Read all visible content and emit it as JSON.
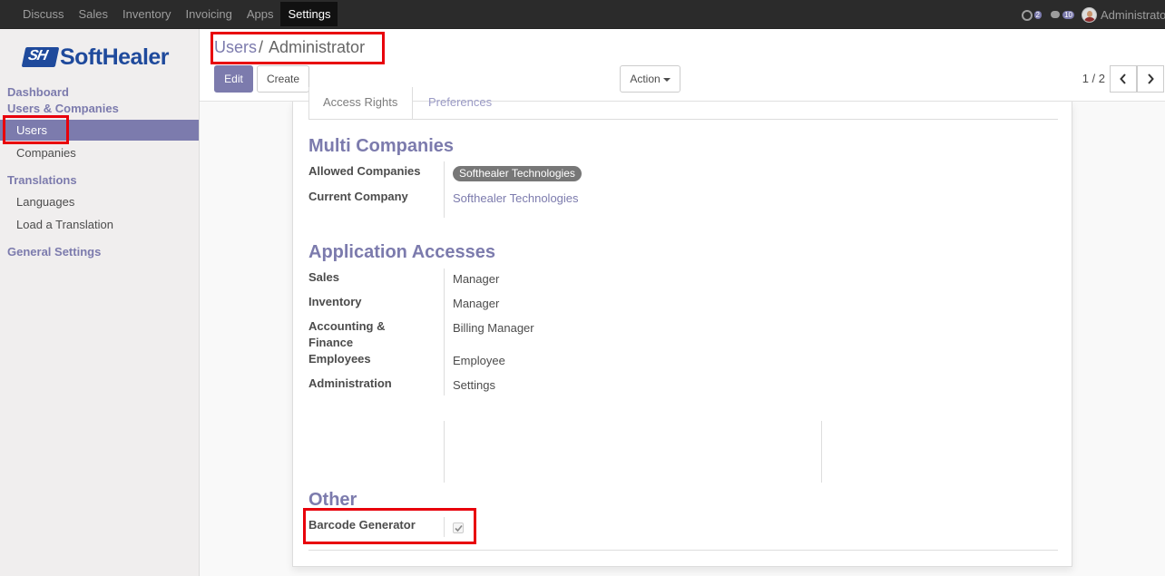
{
  "topbar": {
    "menu": [
      "Discuss",
      "Sales",
      "Inventory",
      "Invoicing",
      "Apps",
      "Settings"
    ],
    "active_menu": "Settings",
    "activity_count": "2",
    "message_count": "10",
    "username": "Administrator"
  },
  "sidebar": {
    "logo_mark": "SH",
    "logo_text": "SoftHealer",
    "dashboard": "Dashboard",
    "users_companies": "Users & Companies",
    "users": "Users",
    "companies": "Companies",
    "translations": "Translations",
    "languages": "Languages",
    "load_translation": "Load a Translation",
    "general_settings": "General Settings"
  },
  "controlpanel": {
    "breadcrumb_parent": "Users",
    "breadcrumb_sep": "/",
    "breadcrumb_current": "Administrator",
    "edit": "Edit",
    "create": "Create",
    "action": "Action",
    "pager": "1 / 2"
  },
  "form": {
    "tabs": {
      "access_rights": "Access Rights",
      "preferences": "Preferences"
    },
    "multi_companies": {
      "title": "Multi Companies",
      "allowed_label": "Allowed Companies",
      "allowed_value": "Softhealer Technologies",
      "current_label": "Current Company",
      "current_value": "Softhealer Technologies"
    },
    "application_accesses": {
      "title": "Application Accesses",
      "sales_label": "Sales",
      "sales_value": "Manager",
      "inventory_label": "Inventory",
      "inventory_value": "Manager",
      "accounting_label_1": "Accounting &",
      "accounting_label_2": "Finance",
      "accounting_value": "Billing Manager",
      "employees_label": "Employees",
      "employees_value": "Employee",
      "administration_label": "Administration",
      "administration_value": "Settings"
    },
    "other": {
      "title": "Other",
      "barcode_label": "Barcode Generator",
      "barcode_checked": true
    }
  },
  "colors": {
    "brand": "#7c7bad",
    "highlight": "#e8000b",
    "navbar": "#2b2b2b",
    "logo": "#1f4a9c"
  }
}
